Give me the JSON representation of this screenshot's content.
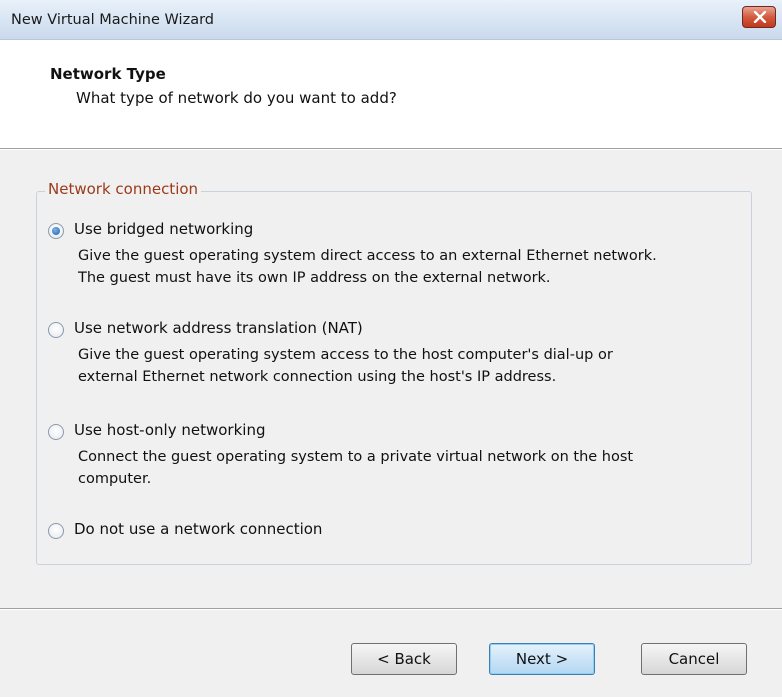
{
  "window": {
    "title": "New Virtual Machine Wizard",
    "close_icon": "close-icon",
    "accent_close_color": "#c0391d"
  },
  "header": {
    "title": "Network Type",
    "subtitle": "What type of network do you want to add?"
  },
  "group": {
    "legend": "Network connection",
    "legend_color": "#9b3a1c",
    "options": [
      {
        "label": "Use bridged networking",
        "selected": true,
        "description": [
          "Give the guest operating system direct access to an external Ethernet network.",
          "The guest must have its own IP address on the external network."
        ]
      },
      {
        "label": "Use network address translation (NAT)",
        "selected": false,
        "description": [
          "Give the guest operating system access to the host computer's dial-up or",
          "external Ethernet network connection using the host's IP address."
        ]
      },
      {
        "label": "Use host-only networking",
        "selected": false,
        "description": [
          "Connect the guest operating system to a private virtual network on the host",
          "computer."
        ]
      },
      {
        "label": "Do not use a network connection",
        "selected": false,
        "description": []
      }
    ]
  },
  "buttons": {
    "back": "< Back",
    "next": "Next >",
    "cancel": "Cancel"
  }
}
